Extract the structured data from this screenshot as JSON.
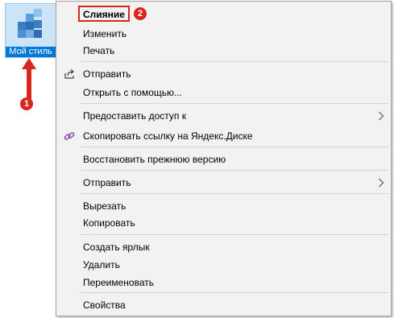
{
  "desktop": {
    "icon_label": "Мой стиль",
    "icon_name": "registry-file-icon"
  },
  "annotations": {
    "badge_1": "1",
    "badge_2": "2",
    "accent_color": "#d9261c"
  },
  "menu": {
    "items": [
      {
        "label": "Слияние",
        "bold": true
      },
      {
        "label": "Изменить"
      },
      {
        "label": "Печать"
      },
      {
        "label": "Отправить",
        "icon": "share-icon"
      },
      {
        "label": "Открыть с помощью..."
      },
      {
        "label": "Предоставить доступ к",
        "submenu": true
      },
      {
        "label": "Скопировать ссылку на Яндекс.Диске",
        "icon": "link-icon"
      },
      {
        "label": "Восстановить прежнюю версию"
      },
      {
        "label": "Отправить",
        "submenu": true
      },
      {
        "label": "Вырезать"
      },
      {
        "label": "Копировать"
      },
      {
        "label": "Создать ярлык"
      },
      {
        "label": "Удалить"
      },
      {
        "label": "Переименовать"
      },
      {
        "label": "Свойства"
      }
    ]
  }
}
